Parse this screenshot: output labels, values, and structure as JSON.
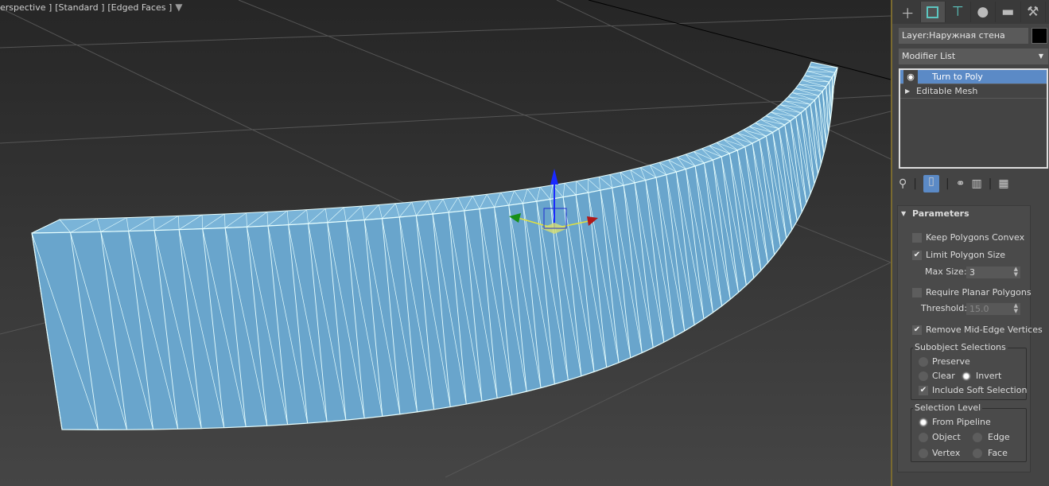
{
  "viewport": {
    "label_parts": [
      "erspective ]",
      "[Standard ]",
      "[Edged Faces ]"
    ],
    "filter_icon": "filter-icon",
    "mesh_color": "#69a5cc",
    "wire_color": "#e8ffff"
  },
  "panel": {
    "tabs": [
      {
        "name": "create",
        "icon": "plus-icon"
      },
      {
        "name": "modify",
        "icon": "modify-icon"
      },
      {
        "name": "hierarchy",
        "icon": "hierarchy-icon"
      },
      {
        "name": "motion",
        "icon": "motion-icon"
      },
      {
        "name": "display",
        "icon": "display-icon"
      },
      {
        "name": "utilities",
        "icon": "wrench-icon"
      }
    ],
    "object_name": "Layer:Наружная стена",
    "object_color": "#000000",
    "modifier_list": "Modifier List",
    "stack": [
      {
        "label": "Turn to Poly",
        "selected": true
      },
      {
        "label": "Editable Mesh",
        "selected": false
      }
    ],
    "parameters": {
      "title": "Parameters",
      "keep_convex": {
        "label": "Keep Polygons Convex",
        "checked": false
      },
      "limit_size": {
        "label": "Limit Polygon Size",
        "checked": true
      },
      "max_size": {
        "label": "Max Size:",
        "value": "3"
      },
      "require_planar": {
        "label": "Require Planar Polygons",
        "checked": false
      },
      "threshold": {
        "label": "Threshold:",
        "value": "15.0"
      },
      "remove_mid": {
        "label": "Remove Mid-Edge Vertices",
        "checked": true
      },
      "subobject": {
        "title": "Subobject Selections",
        "preserve": "Preserve",
        "clear": "Clear",
        "invert": "Invert",
        "soft": "Include Soft Selection",
        "selected": "Invert",
        "soft_checked": true
      },
      "level": {
        "title": "Selection Level",
        "from_pipeline": "From Pipeline",
        "object": "Object",
        "edge": "Edge",
        "vertex": "Vertex",
        "face": "Face",
        "selected": "From Pipeline"
      }
    }
  }
}
